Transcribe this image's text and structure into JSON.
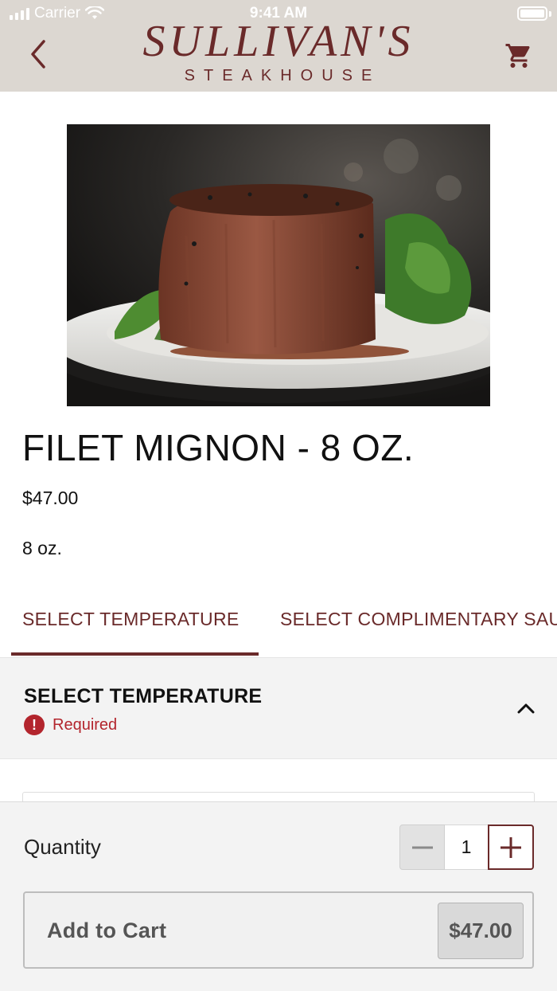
{
  "status_bar": {
    "carrier": "Carrier",
    "time": "9:41 AM"
  },
  "header": {
    "brand_name": "SULLIVAN'S",
    "brand_sub": "STEAKHOUSE",
    "back_icon": "chevron-left-icon",
    "cart_icon": "cart-icon"
  },
  "product": {
    "image": "filet-mignon-photo",
    "title": "FILET MIGNON - 8 OZ.",
    "price": "$47.00",
    "description": "8 oz."
  },
  "tabs": [
    {
      "label": "SELECT TEMPERATURE",
      "active": true
    },
    {
      "label": "SELECT COMPLIMENTARY SAUCE",
      "active": false
    }
  ],
  "section": {
    "title": "SELECT TEMPERATURE",
    "required_label": "Required",
    "required_icon": "alert-icon",
    "collapse_icon": "chevron-up-icon"
  },
  "bottom_bar": {
    "quantity_label": "Quantity",
    "quantity_value": "1",
    "add_to_cart_label": "Add to Cart",
    "add_to_cart_price": "$47.00"
  },
  "colors": {
    "brand": "#6a2a2a",
    "header_bg": "#dcd7d1",
    "required": "#b3252d"
  }
}
